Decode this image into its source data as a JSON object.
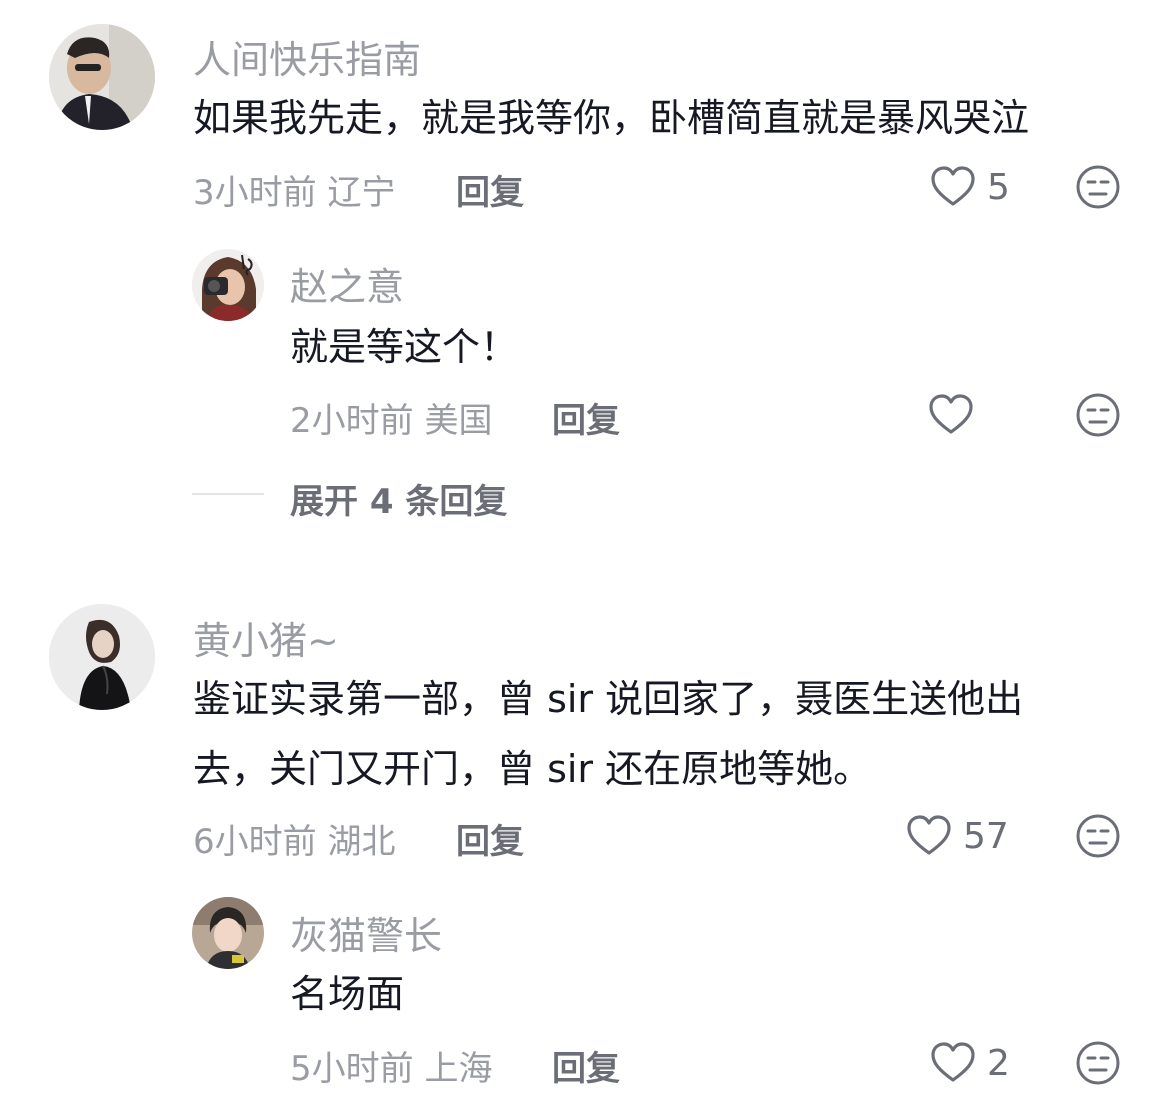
{
  "comments": [
    {
      "user": "人间快乐指南",
      "text_lines": [
        "如果我先走，就是我等你，卧槽简直就是暴风哭泣"
      ],
      "time": "3小时前",
      "location": "辽宁",
      "reply_label": "回复",
      "likes": "5",
      "replies": [
        {
          "user": "赵之意",
          "text_lines": [
            "就是等这个！"
          ],
          "time": "2小时前",
          "location": "美国",
          "reply_label": "回复",
          "likes": ""
        }
      ],
      "expand_label": "展开 4 条回复"
    },
    {
      "user": "黄小猪~",
      "text_lines": [
        "鉴证实录第一部，曾 sir 说回家了，聂医生送他出",
        "去，关门又开门，曾 sir 还在原地等她。"
      ],
      "time": "6小时前",
      "location": "湖北",
      "reply_label": "回复",
      "likes": "57",
      "replies": [
        {
          "user": "灰猫警长",
          "text_lines": [
            "名场面"
          ],
          "time": "5小时前",
          "location": "上海",
          "reply_label": "回复",
          "likes": "2"
        }
      ]
    }
  ],
  "icons": {
    "like": "heart-outline-icon",
    "dislike": "meh-face-icon"
  },
  "colors": {
    "text": "#161823",
    "secondary": "#9a9ca3",
    "action": "#6b6e77"
  }
}
